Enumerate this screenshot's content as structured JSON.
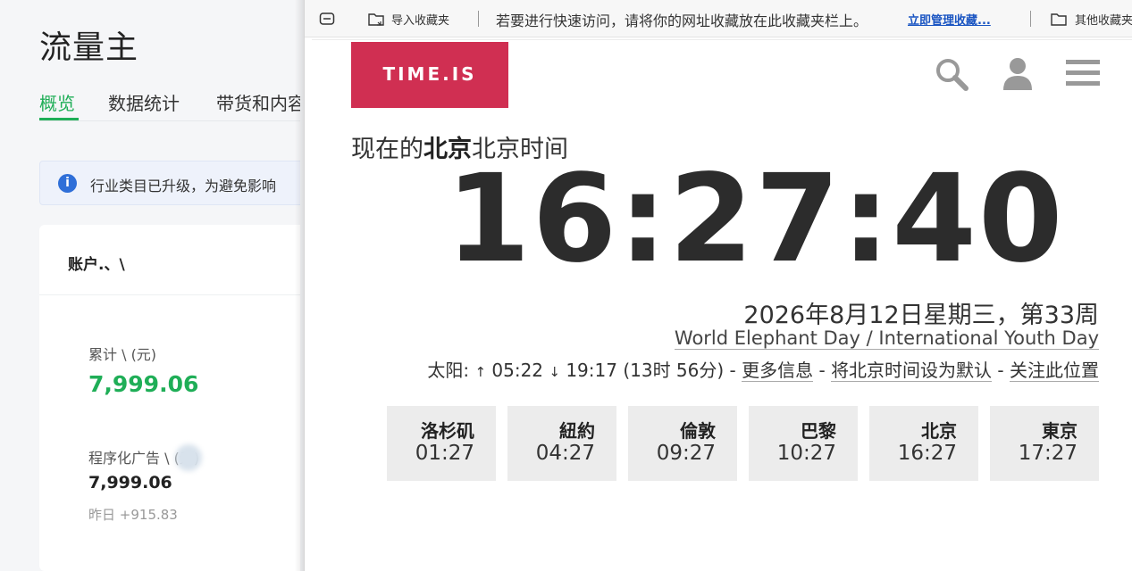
{
  "left_app": {
    "title": "流量主",
    "tabs": [
      "概览",
      "数据统计",
      "带货和内容"
    ],
    "notice_text": "行业类目已升级，为避免影响",
    "card_title": "账户.、\\",
    "cumulative_label": "累计 \\ (元)",
    "cumulative_value": "7,999.06",
    "programmatic_label": "程序化广告 \\ (元)",
    "programmatic_value": "7,999.06",
    "yesterday_label": "昨日",
    "yesterday_value": "+915.83"
  },
  "bookmarks": {
    "import_label": "导入收藏夹",
    "hint": "若要进行快速访问，请将你的网址收藏放在此收藏夹栏上。",
    "manage_link": "立即管理收藏...",
    "other_label": "其他收藏夹"
  },
  "page": {
    "logo": "TIME.IS",
    "heading_prefix": "现在的",
    "heading_city": "北京",
    "heading_suffix": "北京时间",
    "clock": "16:27:40",
    "date": "2026年8月12日星期三，第33周",
    "holiday": "World Elephant Day / International Youth Day",
    "sun": {
      "label": "太阳:",
      "sunrise": "05:22",
      "sunset": "19:17",
      "daylength": "(13时 56分)",
      "more_info": "更多信息",
      "set_default": "将北京时间设为默认",
      "follow": "关注此位置"
    },
    "cities": [
      {
        "name": "洛杉矶",
        "time": "01:27"
      },
      {
        "name": "紐約",
        "time": "04:27"
      },
      {
        "name": "倫敦",
        "time": "09:27"
      },
      {
        "name": "巴黎",
        "time": "10:27"
      },
      {
        "name": "北京",
        "time": "16:27"
      },
      {
        "name": "東京",
        "time": "17:27"
      }
    ]
  },
  "icons": [
    "search-icon",
    "user-icon",
    "menu-icon",
    "folder-icon",
    "import-bookmark-icon",
    "tab-icon",
    "info-icon"
  ],
  "colors": {
    "accent_green": "#1fae57",
    "logo_red": "#d02f52",
    "link_blue": "#1a55c2"
  }
}
